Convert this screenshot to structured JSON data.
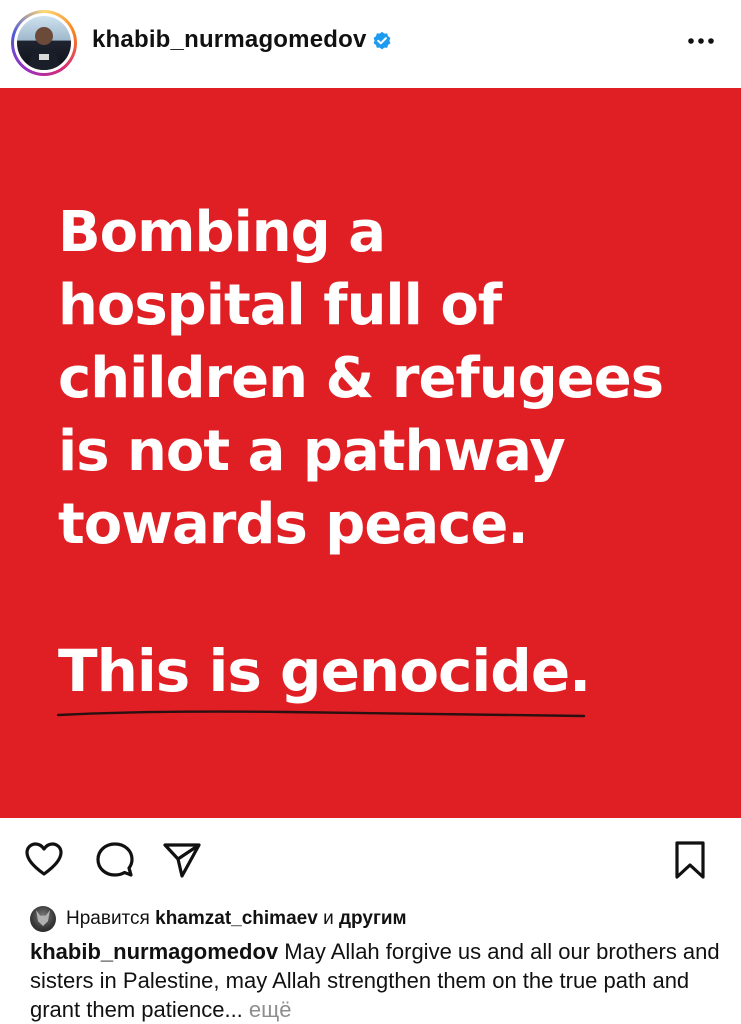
{
  "header": {
    "username": "khabib_nurmagomedov",
    "verified": true,
    "more_icon": "more-horizontal-icon"
  },
  "post": {
    "background_color": "#e01f25",
    "text_color": "#ffffff",
    "lines": [
      "Bombing a",
      "hospital full of",
      "children & refugees",
      "is not a pathway",
      "towards peace."
    ],
    "emphasis": "This is genocide."
  },
  "actions": {
    "like_icon": "heart-icon",
    "comment_icon": "comment-icon",
    "share_icon": "send-icon",
    "save_icon": "bookmark-icon"
  },
  "likes": {
    "prefix": "Нравится",
    "user": "khamzat_chimaev",
    "joiner": "и",
    "suffix": "другим"
  },
  "caption": {
    "username": "khabib_nurmagomedov",
    "text": "May Allah forgive us and all our brothers and sisters in Palestine, may Allah strengthen them on the true path and grant them patience...",
    "more_label": "ещё"
  }
}
